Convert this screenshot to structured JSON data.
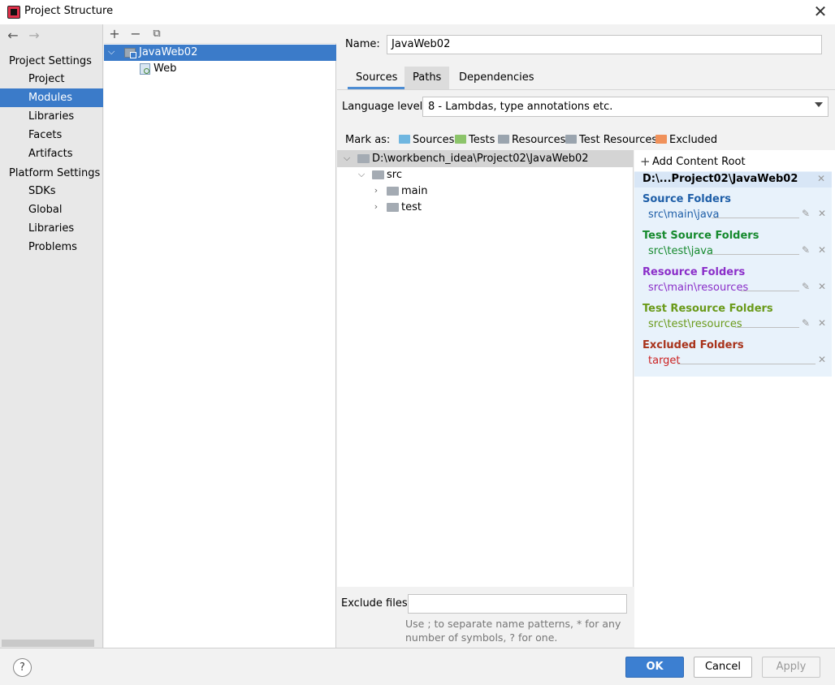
{
  "window": {
    "title": "Project Structure"
  },
  "nav": {
    "project_settings": "Project Settings",
    "items_project": [
      "Project",
      "Modules",
      "Libraries",
      "Facets",
      "Artifacts"
    ],
    "platform_settings": "Platform Settings",
    "items_platform": [
      "SDKs",
      "Global Libraries"
    ],
    "problems": "Problems",
    "selected": "Modules"
  },
  "modules": {
    "toolbar": [
      "add-icon",
      "remove-icon",
      "copy-icon"
    ],
    "tree": [
      {
        "label": "JavaWeb02",
        "selected": true
      },
      {
        "label": "Web"
      }
    ]
  },
  "name_field": {
    "label": "Name:",
    "value": "JavaWeb02"
  },
  "tabs": [
    "Sources",
    "Paths",
    "Dependencies"
  ],
  "active_tab": "Sources",
  "language_level": {
    "label": "Language level:",
    "value": "8 - Lambdas, type annotations etc."
  },
  "mark_as": {
    "label": "Mark as:",
    "items": [
      {
        "label": "Sources",
        "color": "#6fb6e0"
      },
      {
        "label": "Tests",
        "color": "#8cc46a"
      },
      {
        "label": "Resources",
        "color": "#9aa4ae"
      },
      {
        "label": "Test Resources",
        "color": "#9aa4ae"
      },
      {
        "label": "Excluded",
        "color": "#f0915a"
      }
    ]
  },
  "source_tree": {
    "root": "D:\\workbench_idea\\Project02\\JavaWeb02",
    "src": "src",
    "main": "main",
    "test": "test"
  },
  "content_root": {
    "add_label": "Add Content Root",
    "path": "D:\\...Project02\\JavaWeb02",
    "sections": [
      {
        "title": "Source Folders",
        "path": "src\\main\\java",
        "color": "#1f5fa8"
      },
      {
        "title": "Test Source Folders",
        "path": "src\\test\\java",
        "color": "#168a2e"
      },
      {
        "title": "Resource Folders",
        "path": "src\\main\\resources",
        "color": "#8b2fc9"
      },
      {
        "title": "Test Resource Folders",
        "path": "src\\test\\resources",
        "color": "#6a9a1a"
      },
      {
        "title": "Excluded Folders",
        "path": "target",
        "color": "#a8321a"
      }
    ]
  },
  "exclude": {
    "label": "Exclude files:",
    "value": "",
    "hint": "Use ; to separate name patterns, * for any number of symbols, ? for one."
  },
  "buttons": {
    "ok": "OK",
    "cancel": "Cancel",
    "apply": "Apply",
    "help": "?"
  }
}
